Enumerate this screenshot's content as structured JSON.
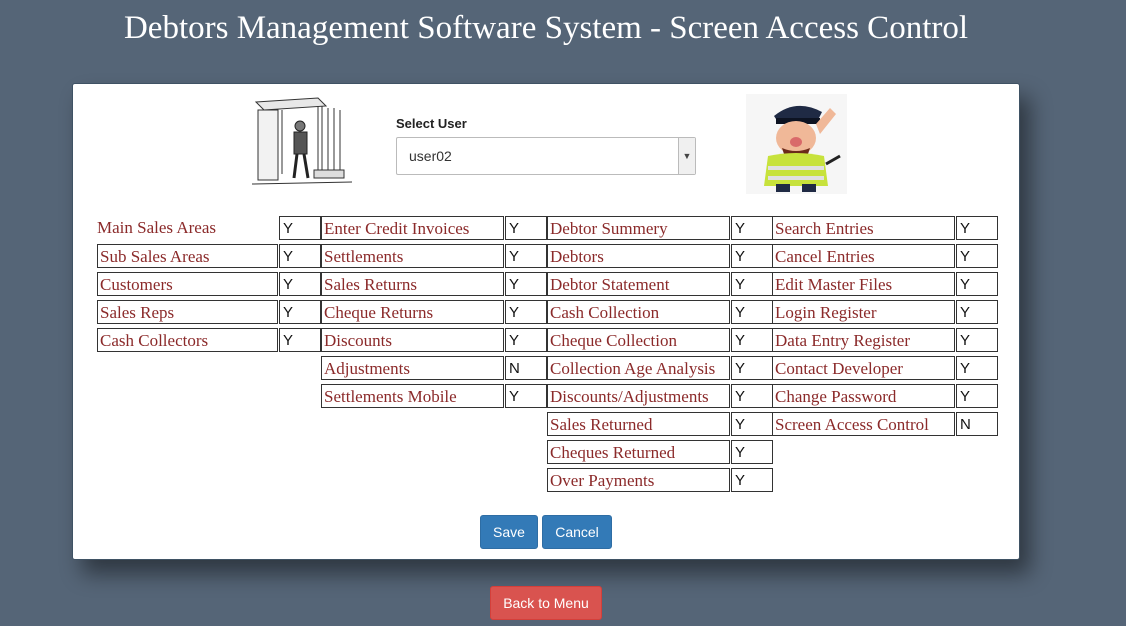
{
  "title": "Debtors Management Software System - Screen Access Control",
  "select_user": {
    "label": "Select User",
    "value": "user02"
  },
  "columns": [
    [
      {
        "label": "Main Sales Areas",
        "value": "Y"
      },
      {
        "label": "Sub Sales Areas",
        "value": "Y"
      },
      {
        "label": "Customers",
        "value": "Y"
      },
      {
        "label": "Sales Reps",
        "value": "Y"
      },
      {
        "label": "Cash Collectors",
        "value": "Y"
      }
    ],
    [
      {
        "label": "Enter Credit Invoices",
        "value": "Y"
      },
      {
        "label": "Settlements",
        "value": "Y"
      },
      {
        "label": "Sales Returns",
        "value": "Y"
      },
      {
        "label": "Cheque Returns",
        "value": "Y"
      },
      {
        "label": "Discounts",
        "value": "Y"
      },
      {
        "label": "Adjustments",
        "value": "N"
      },
      {
        "label": "Settlements Mobile",
        "value": "Y"
      }
    ],
    [
      {
        "label": "Debtor Summery",
        "value": "Y"
      },
      {
        "label": "Debtors",
        "value": "Y"
      },
      {
        "label": "Debtor Statement",
        "value": "Y"
      },
      {
        "label": "Cash Collection",
        "value": "Y"
      },
      {
        "label": "Cheque Collection",
        "value": "Y"
      },
      {
        "label": "Collection Age Analysis",
        "value": "Y"
      },
      {
        "label": "Discounts/Adjustments",
        "value": "Y"
      },
      {
        "label": "Sales Returned",
        "value": "Y"
      },
      {
        "label": "Cheques Returned",
        "value": "Y"
      },
      {
        "label": "Over Payments",
        "value": "Y"
      }
    ],
    [
      {
        "label": "Search Entries",
        "value": "Y"
      },
      {
        "label": "Cancel Entries",
        "value": "Y"
      },
      {
        "label": "Edit Master Files",
        "value": "Y"
      },
      {
        "label": "Login Register",
        "value": "Y"
      },
      {
        "label": "Data Entry Register",
        "value": "Y"
      },
      {
        "label": "Contact Developer",
        "value": "Y"
      },
      {
        "label": "Change Password",
        "value": "Y"
      },
      {
        "label": "Screen Access Control",
        "value": "N"
      }
    ]
  ],
  "buttons": {
    "save": "Save",
    "cancel": "Cancel",
    "back": "Back to Menu"
  },
  "colors": {
    "background": "#556577",
    "label_text": "#8b2a2a",
    "primary": "#337ab7",
    "danger": "#d9534f"
  }
}
